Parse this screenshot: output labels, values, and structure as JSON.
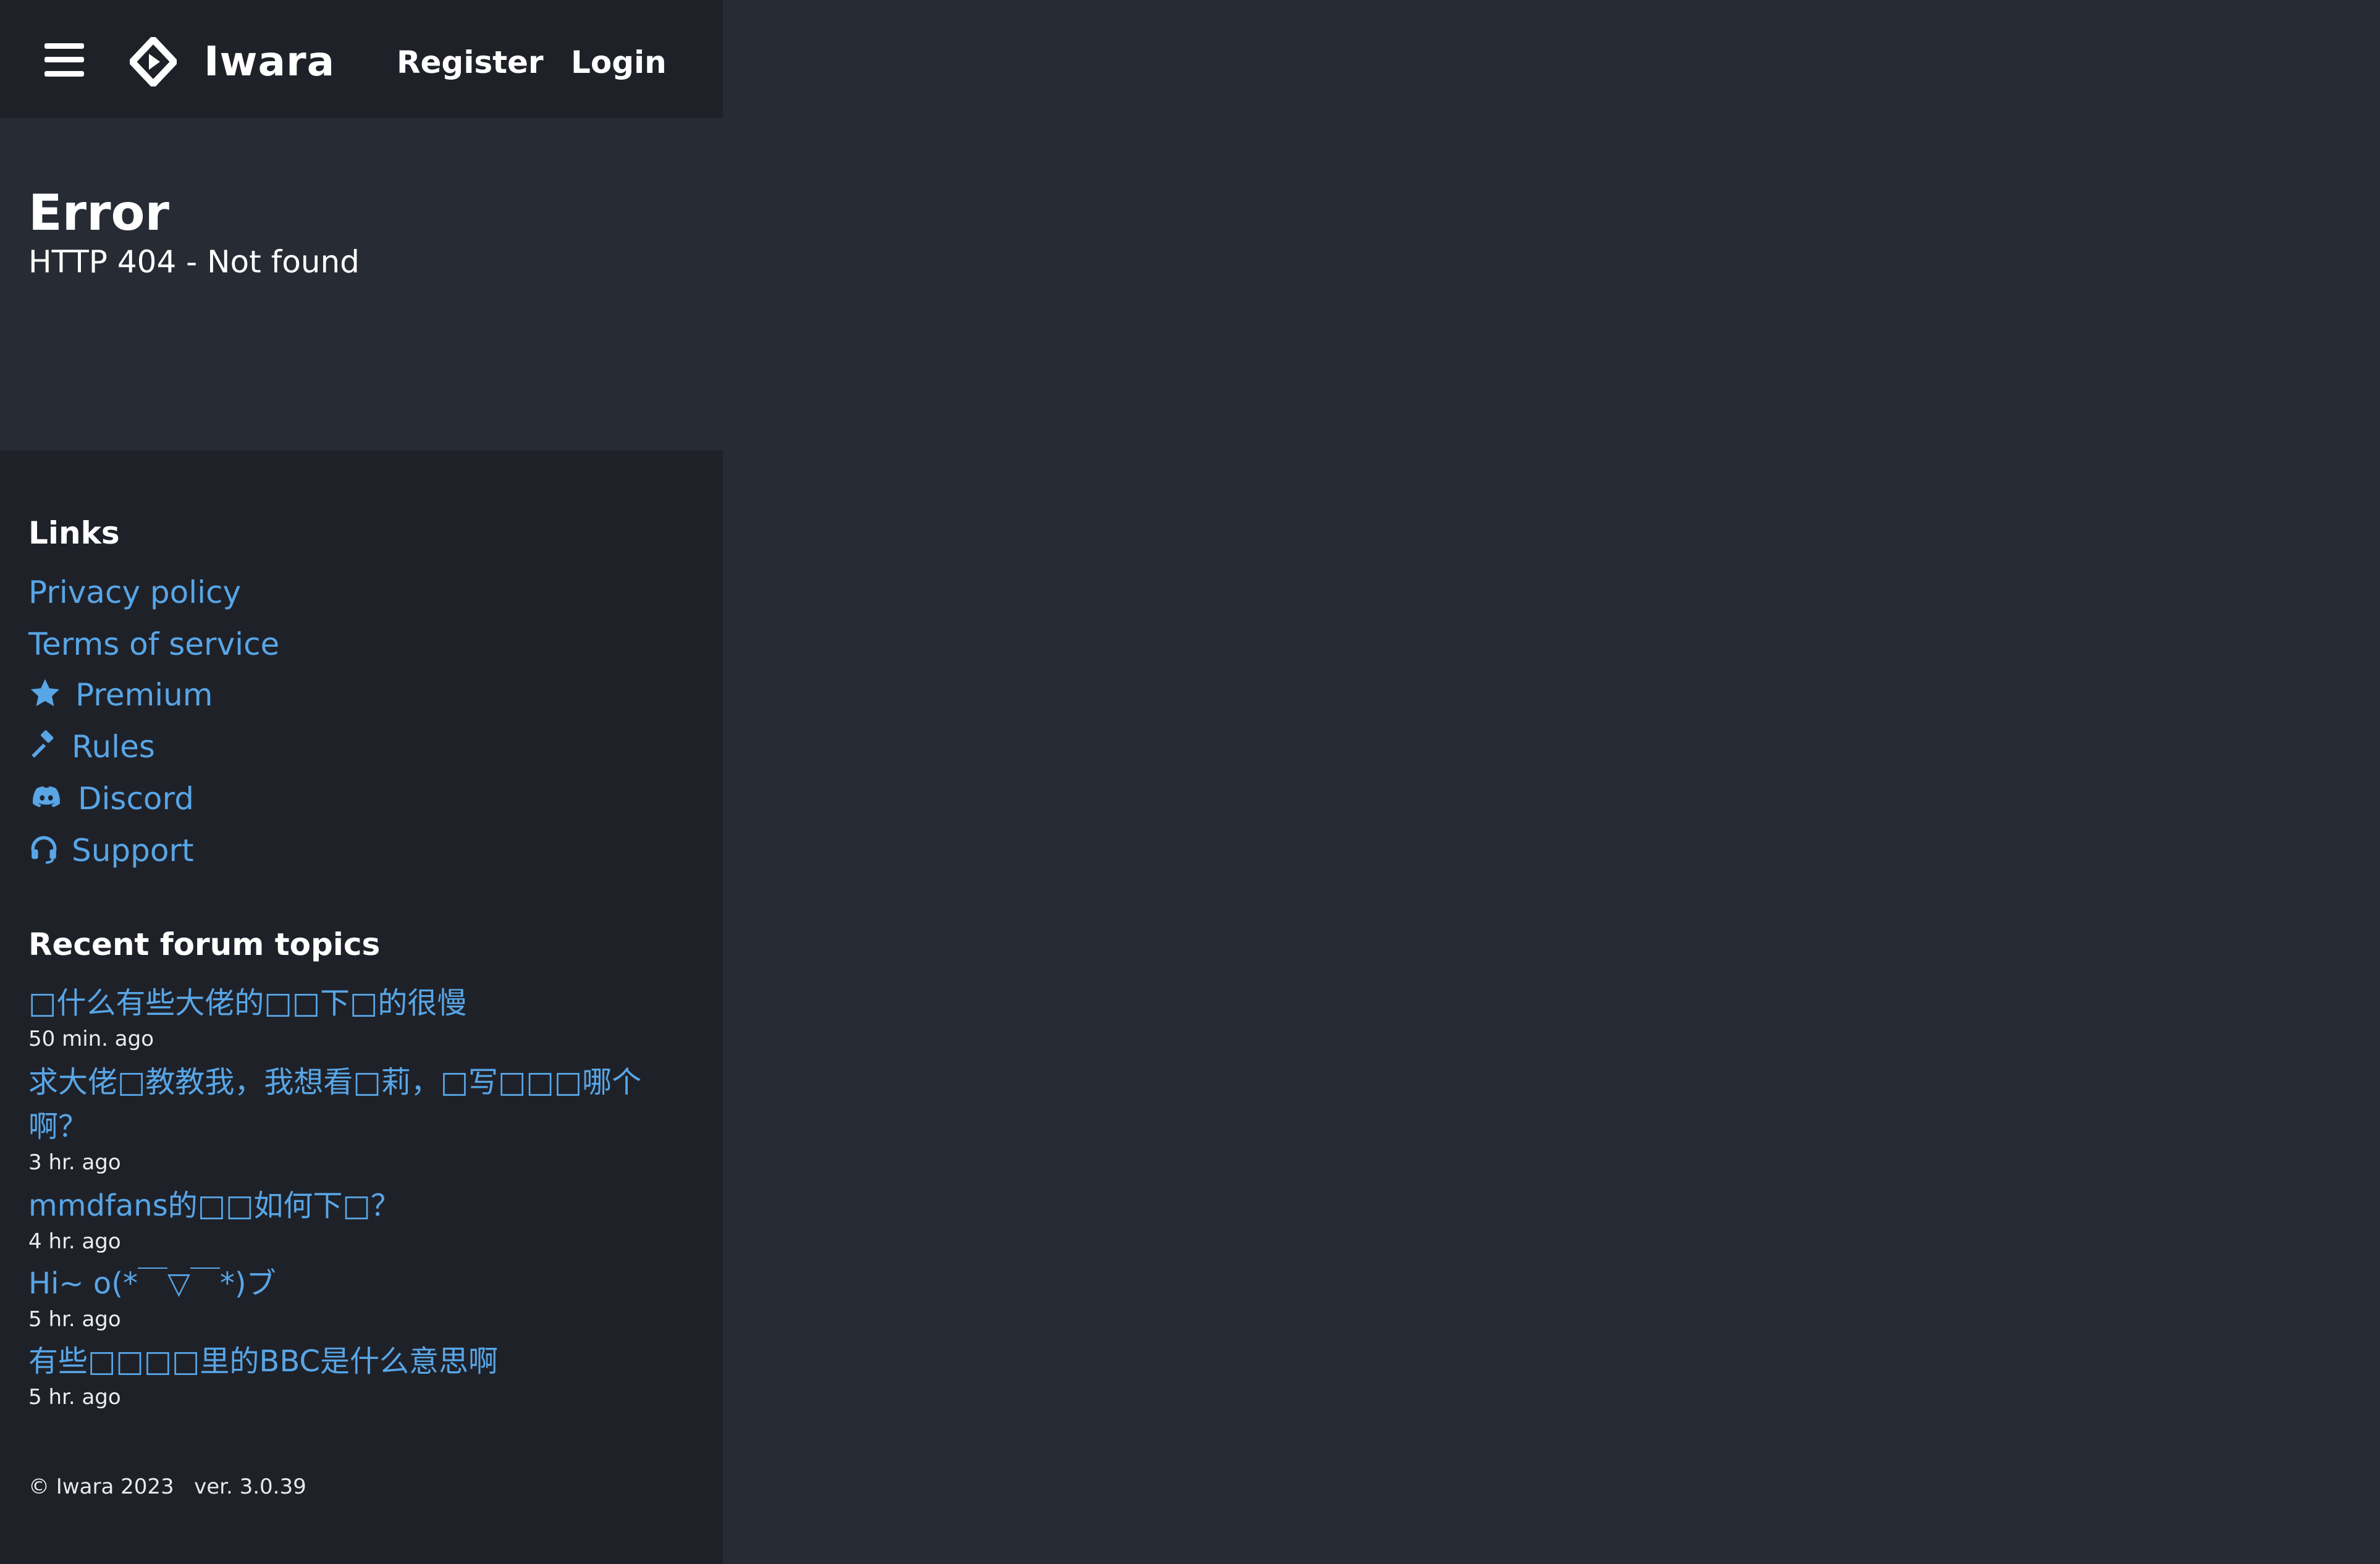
{
  "header": {
    "brand": "Iwara",
    "register_label": "Register",
    "login_label": "Login",
    "icons": {
      "menu": "hamburger-menu-icon",
      "logo": "iwara-logo-icon"
    }
  },
  "error": {
    "title": "Error",
    "message": "HTTP 404 - Not found"
  },
  "links": {
    "title": "Links",
    "items": [
      {
        "label": "Privacy policy",
        "icon": ""
      },
      {
        "label": "Terms of service",
        "icon": ""
      },
      {
        "label": "Premium",
        "icon": "star-icon"
      },
      {
        "label": "Rules",
        "icon": "gavel-icon"
      },
      {
        "label": "Discord",
        "icon": "discord-icon"
      },
      {
        "label": "Support",
        "icon": "headset-icon"
      }
    ]
  },
  "forum": {
    "title": "Recent forum topics",
    "topics": [
      {
        "title": "□什么有些大佬的□□下□的很慢",
        "time": "50 min. ago"
      },
      {
        "title": "求大佬□教教我，我想看□莉，□写□□□哪个啊？",
        "time": "3 hr. ago"
      },
      {
        "title": "mmdfans的□□如何下□？",
        "time": "4 hr. ago"
      },
      {
        "title": "Hi~ o(*￣▽￣*)ブ",
        "time": "5 hr. ago"
      },
      {
        "title": "有些□□□□里的BBC是什么意思啊",
        "time": "5 hr. ago"
      }
    ]
  },
  "footer": {
    "copyright": "© Iwara 2023",
    "version": "ver. 3.0.39"
  },
  "colors": {
    "background": "#272b34",
    "sidebar": "#1f2129",
    "link": "#58a6e6",
    "text": "#ffffff"
  }
}
